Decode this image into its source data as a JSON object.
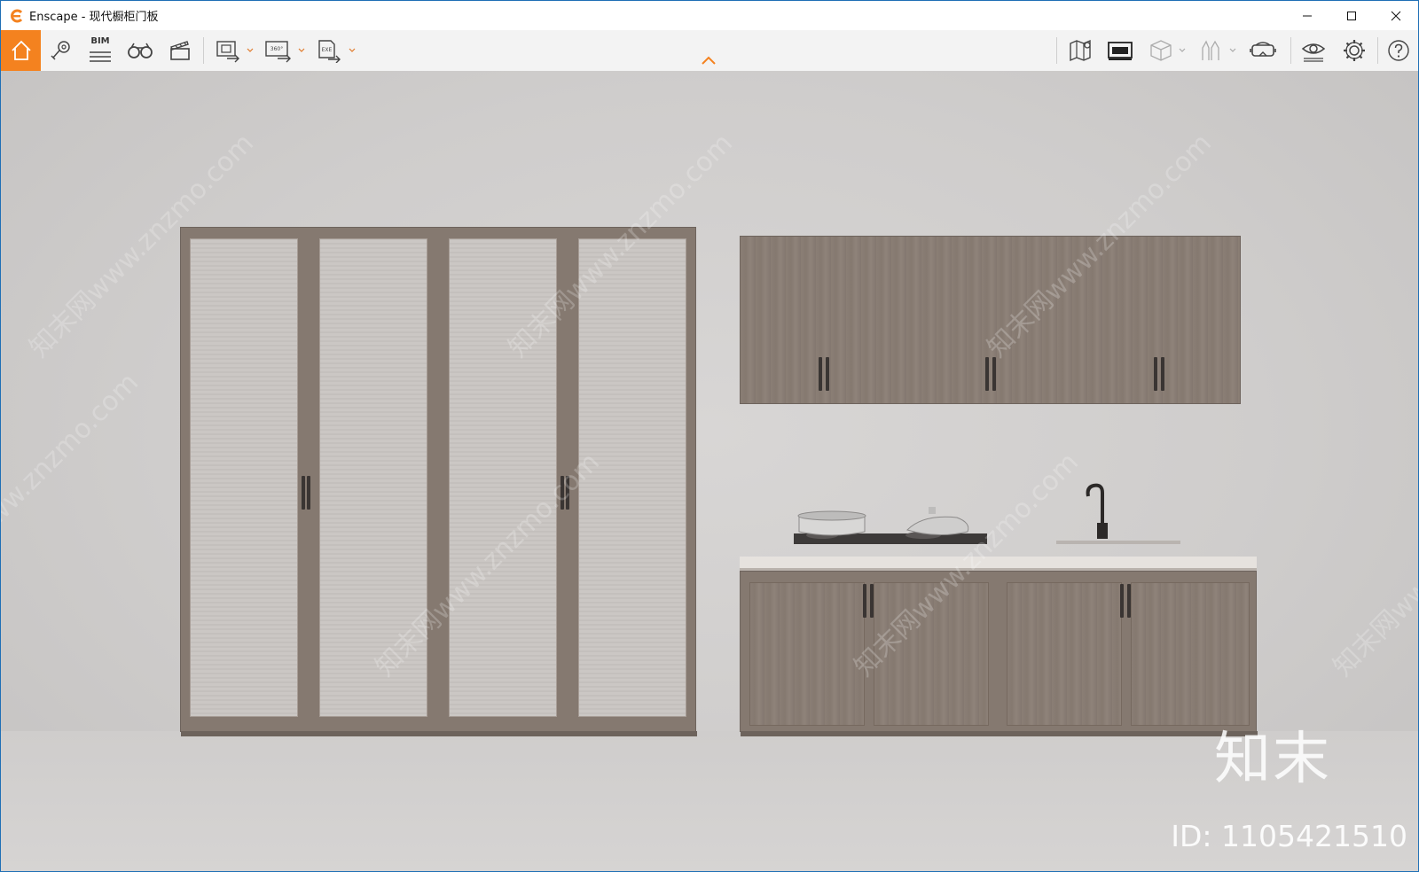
{
  "window": {
    "title": "Enscape - 现代橱柜门板",
    "accent_color": "#f4821f",
    "border_color": "#1f6fb5",
    "controls": [
      "minimize-icon",
      "maximize-icon",
      "close-icon"
    ]
  },
  "toolbar": {
    "left": [
      {
        "name": "home",
        "icon": "home-icon",
        "active": true
      },
      {
        "name": "views",
        "icon": "location-views-icon"
      },
      {
        "name": "bim",
        "icon": "bim-icon",
        "label": "BIM"
      },
      {
        "name": "binoculars",
        "icon": "binoculars-icon"
      },
      {
        "name": "video-editor",
        "icon": "clapperboard-icon"
      },
      {
        "name": "render-image",
        "icon": "render-image-icon",
        "dropdown": true
      },
      {
        "name": "render-panorama",
        "icon": "panorama-360-icon",
        "label": "360°",
        "dropdown": true
      },
      {
        "name": "export-exe",
        "icon": "export-exe-icon",
        "label": "EXE",
        "dropdown": true
      }
    ],
    "right": [
      {
        "name": "map",
        "icon": "map-icon"
      },
      {
        "name": "asset-library",
        "icon": "asset-library-icon"
      },
      {
        "name": "cube",
        "icon": "cube-icon",
        "dropdown": true
      },
      {
        "name": "people",
        "icon": "people-icon",
        "dropdown": true
      },
      {
        "name": "vr",
        "icon": "vr-headset-icon"
      },
      {
        "name": "visual-settings",
        "icon": "eye-icon"
      },
      {
        "name": "settings",
        "icon": "gear-icon"
      },
      {
        "name": "help",
        "icon": "help-icon"
      }
    ]
  },
  "viewport": {
    "watermark_text": "知末网www.znzmo.com",
    "brand": "知末",
    "id_text": "ID: 1105421510"
  }
}
